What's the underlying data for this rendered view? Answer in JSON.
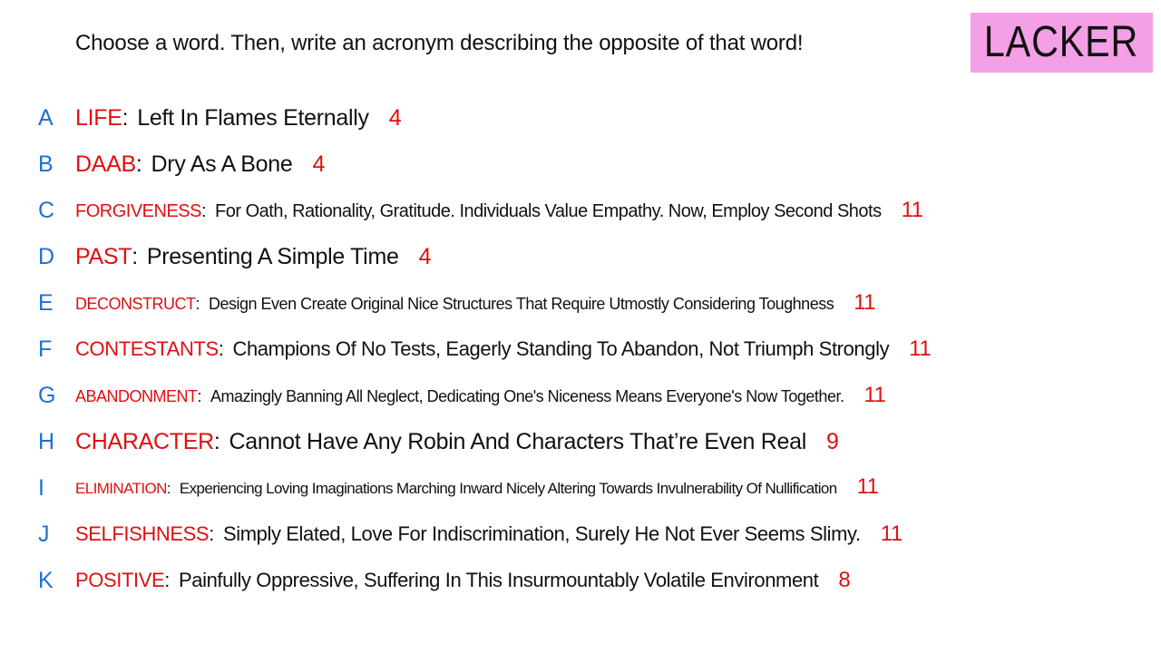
{
  "prompt": "Choose a word. Then, write an acronym describing the opposite of that word!",
  "badge": {
    "label": "LACKER",
    "color": "#f4a0e6"
  },
  "colors": {
    "letter": "#1f6fd6",
    "word": "#e01010",
    "text": "#111111",
    "count": "#e01010"
  },
  "entries": [
    {
      "letter": "A",
      "word": "LIFE",
      "colon": ":",
      "acronym": "Left In Flames Eternally",
      "count": "4"
    },
    {
      "letter": "B",
      "word": "DAAB",
      "colon": ":",
      "acronym": "Dry As A Bone",
      "count": "4"
    },
    {
      "letter": "C",
      "word": "FORGIVENESS",
      "colon": ":",
      "acronym": "For Oath, Rationality, Gratitude. Individuals Value Empathy. Now, Employ Second Shots",
      "count": "11"
    },
    {
      "letter": "D",
      "word": "PAST",
      "colon": ":",
      "acronym": "Presenting A Simple Time",
      "count": "4"
    },
    {
      "letter": "E",
      "word": "DECONSTRUCT",
      "colon": ":",
      "acronym": "Design Even Create Original Nice Structures That Require Utmostly Considering Toughness",
      "count": "11"
    },
    {
      "letter": "F",
      "word": "CONTESTANTS",
      "colon": ":",
      "acronym": "Champions Of No Tests, Eagerly Standing To Abandon, Not Triumph Strongly",
      "count": "11"
    },
    {
      "letter": "G",
      "word": "ABANDONMENT",
      "colon": ":",
      "acronym": "Amazingly Banning All Neglect, Dedicating One's Niceness Means Everyone's Now Together.",
      "count": "11"
    },
    {
      "letter": "H",
      "word": "CHARACTER",
      "colon": ":",
      "acronym": "Cannot Have Any Robin And Characters That’re Even Real",
      "count": "9"
    },
    {
      "letter": "I",
      "word": "ELIMINATION",
      "colon": ":",
      "acronym": "Experiencing Loving Imaginations Marching Inward Nicely Altering Towards Invulnerability Of Nullification",
      "count": "11"
    },
    {
      "letter": "J",
      "word": "SELFISHNESS",
      "colon": ":",
      "acronym": "Simply Elated, Love For Indiscrimination, Surely He Not Ever Seems Slimy.",
      "count": "11"
    },
    {
      "letter": "K",
      "word": "POSITIVE",
      "colon": ":",
      "acronym": "Painfully Oppressive, Suffering In This Insurmountably Volatile Environment",
      "count": "8"
    }
  ]
}
